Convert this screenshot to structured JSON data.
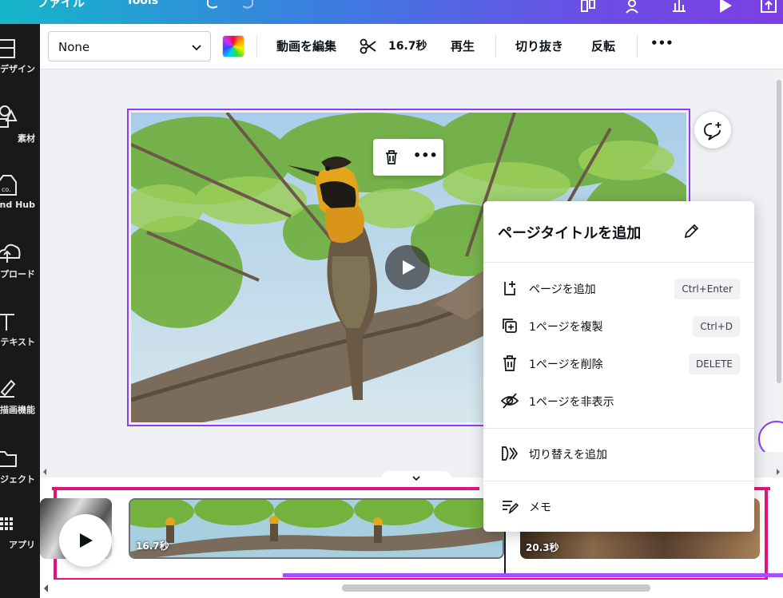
{
  "topbar": {
    "file_label": "ファイル",
    "tools_label": "Tools"
  },
  "sidebar": {
    "items": [
      {
        "label": "デザイン",
        "icon": "layout-icon"
      },
      {
        "label": "素材",
        "icon": "elements-icon"
      },
      {
        "label": "Brand Hub",
        "icon": "brand-hub-icon"
      },
      {
        "label": "アップロード",
        "icon": "upload-icon"
      },
      {
        "label": "テキスト",
        "icon": "text-icon"
      },
      {
        "label": "描画機能",
        "icon": "draw-icon"
      },
      {
        "label": "プロジェクト",
        "icon": "folder-icon"
      },
      {
        "label": "アプリ",
        "icon": "apps-icon"
      }
    ]
  },
  "toolbar": {
    "font_value": "None",
    "edit_video": "動画を編集",
    "duration": "16.7秒",
    "play": "再生",
    "crop": "切り抜き",
    "flip": "反転",
    "more": "•••"
  },
  "canvas": {
    "float_more": "•••"
  },
  "timeline": {
    "clips": [
      {
        "duration": "16.7秒"
      },
      {
        "duration": "20.3秒"
      }
    ]
  },
  "context_menu": {
    "title": "ページタイトルを追加",
    "items": [
      {
        "label": "ページを追加",
        "shortcut": "Ctrl+Enter",
        "icon": "add-page-icon"
      },
      {
        "label": "1ページを複製",
        "shortcut": "Ctrl+D",
        "icon": "duplicate-icon"
      },
      {
        "label": "1ページを削除",
        "shortcut": "DELETE",
        "icon": "trash-icon"
      },
      {
        "label": "1ページを非表示",
        "shortcut": "",
        "icon": "eye-off-icon"
      },
      {
        "label": "切り替えを追加",
        "shortcut": "",
        "icon": "transition-icon"
      },
      {
        "label": "メモ",
        "shortcut": "",
        "icon": "notes-icon"
      }
    ]
  },
  "colors": {
    "accent": "#8b3dff",
    "timeline_highlight": "#e4127c",
    "topbar_start": "#16b6c9",
    "topbar_end": "#7b3fe4"
  }
}
